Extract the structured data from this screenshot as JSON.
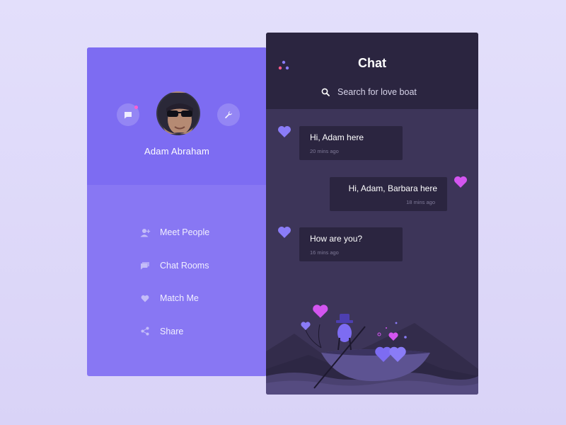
{
  "profile": {
    "name": "Adam Abraham",
    "menu": [
      {
        "label": "Meet People",
        "icon": "add-user-icon"
      },
      {
        "label": "Chat Rooms",
        "icon": "chat-rooms-icon"
      },
      {
        "label": "Match Me",
        "icon": "heart-icon"
      },
      {
        "label": "Share",
        "icon": "share-icon"
      }
    ]
  },
  "chat": {
    "title": "Chat",
    "search_placeholder": "Search for love boat",
    "messages": [
      {
        "text": "Hi, Adam here",
        "time": "20 mins ago",
        "side": "left"
      },
      {
        "text": "Hi, Adam, Barbara here",
        "time": "18 mins ago",
        "side": "right"
      },
      {
        "text": "How are you?",
        "time": "16 mins ago",
        "side": "left"
      }
    ]
  },
  "colors": {
    "accent": "#8877f3",
    "panel_dark": "#2b2540",
    "heart_left": "#8a7cf7",
    "heart_right": "#d355f0",
    "notification": "#ff5fd2"
  }
}
